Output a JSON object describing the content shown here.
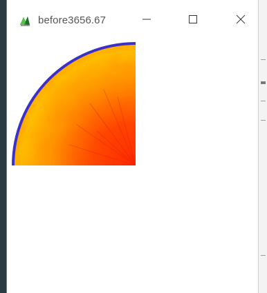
{
  "window": {
    "title": "before3656.67",
    "app_icon": "matlab-figure-icon",
    "controls": {
      "minimize_icon": "minimize-icon",
      "maximize_icon": "maximize-icon",
      "close_icon": "close-icon"
    }
  },
  "figure": {
    "shape": "quarter-disk",
    "colors": {
      "outer_ring": "#3b30c8",
      "edge_yellow": "#ffc400",
      "mid_orange": "#ff9a00",
      "core_red": "#ff2a00"
    }
  }
}
